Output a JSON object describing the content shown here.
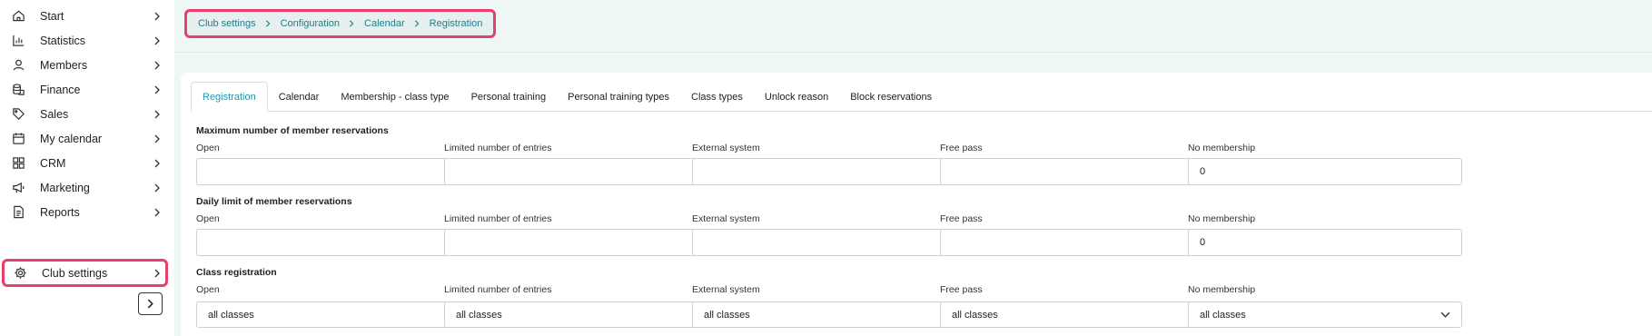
{
  "sidebar": {
    "items": [
      {
        "label": "Start",
        "icon": "home-icon"
      },
      {
        "label": "Statistics",
        "icon": "bar-chart-icon"
      },
      {
        "label": "Members",
        "icon": "user-icon"
      },
      {
        "label": "Finance",
        "icon": "coins-icon"
      },
      {
        "label": "Sales",
        "icon": "tag-icon"
      },
      {
        "label": "My calendar",
        "icon": "calendar-icon"
      },
      {
        "label": "CRM",
        "icon": "grid-icon"
      },
      {
        "label": "Marketing",
        "icon": "megaphone-icon"
      },
      {
        "label": "Reports",
        "icon": "document-icon"
      },
      {
        "label": "Club settings",
        "icon": "gear-icon",
        "active": true
      }
    ],
    "collapse_icon": "chevron-right-icon"
  },
  "breadcrumb": {
    "items": [
      "Club settings",
      "Configuration",
      "Calendar",
      "Registration"
    ]
  },
  "tabs": {
    "items": [
      "Registration",
      "Calendar",
      "Membership - class type",
      "Personal training",
      "Personal training types",
      "Class types",
      "Unlock reason",
      "Block reservations"
    ],
    "active": "Registration"
  },
  "sections": [
    {
      "title": "Maximum number of member reservations",
      "fields": [
        {
          "label": "Open",
          "value": ""
        },
        {
          "label": "Limited number of entries",
          "value": ""
        },
        {
          "label": "External system",
          "value": ""
        },
        {
          "label": "Free pass",
          "value": ""
        },
        {
          "label": "No membership",
          "value": "0"
        }
      ]
    },
    {
      "title": "Daily limit of member reservations",
      "fields": [
        {
          "label": "Open",
          "value": ""
        },
        {
          "label": "Limited number of entries",
          "value": ""
        },
        {
          "label": "External system",
          "value": ""
        },
        {
          "label": "Free pass",
          "value": ""
        },
        {
          "label": "No membership",
          "value": "0"
        }
      ]
    },
    {
      "title": "Class registration",
      "fields": [
        {
          "label": "Open",
          "value": "all classes"
        },
        {
          "label": "Limited number of entries",
          "value": "all classes"
        },
        {
          "label": "External system",
          "value": "all classes"
        },
        {
          "label": "Free pass",
          "value": "all classes"
        },
        {
          "label": "No membership",
          "value": "all classes"
        }
      ]
    }
  ],
  "colors": {
    "accent": "#1b9aaa",
    "highlight": "#e83e6c",
    "main_bg": "#eef6f6"
  }
}
